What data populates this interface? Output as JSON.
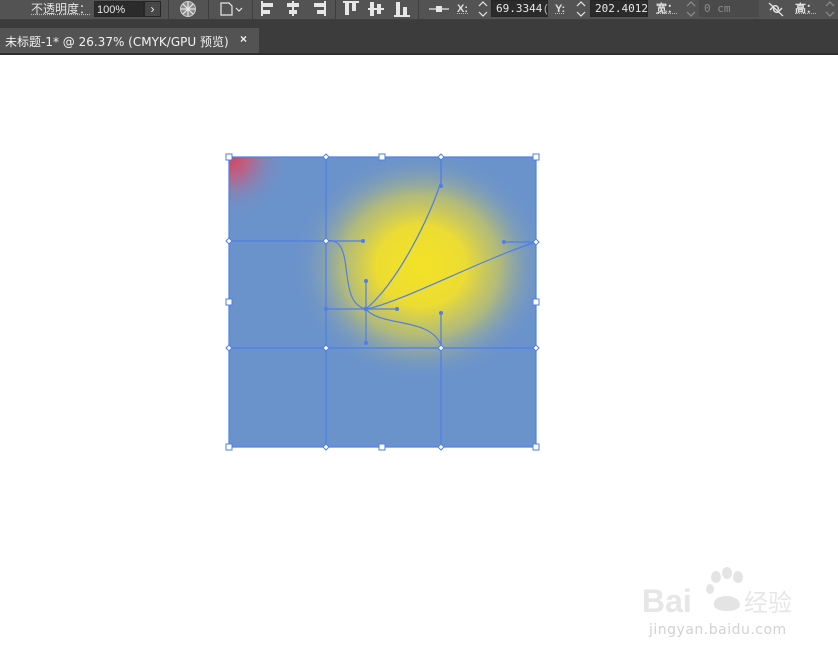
{
  "control_bar": {
    "opacity_label": "不透明度：",
    "opacity_value": "100%",
    "opacity_dropdown_glyph": "›",
    "recolor_icon": "recolor-artwork-icon",
    "shape_menu_icon": "document-shape-dropdown-icon",
    "align_icons": [
      "align-left-icon",
      "align-horizontal-center-icon",
      "align-right-icon",
      "align-top-icon",
      "align-vertical-center-icon",
      "align-bottom-icon"
    ],
    "reference_point_icon": "reference-point-icon",
    "x_label": "X:",
    "x_value": "69.3344",
    "x_trailing": "(",
    "y_label": "Y:",
    "y_value": "202.4012",
    "width_label": "宽：",
    "width_value": "0 cm",
    "link_icon": "constrain-proportions-link-icon",
    "height_label": "高："
  },
  "tab_bar": {
    "tab_title": "未标题-1* @ 26.37% (CMYK/GPU 预览)",
    "close_glyph": "×"
  },
  "artwork": {
    "type": "gradient-mesh",
    "base_color": "#6b93cb",
    "highlight_color": "#f3e226",
    "corner_color": "#d3435f",
    "selection_color": "#4f7ee8"
  },
  "watermark": {
    "logo_text": "Bai du 经验",
    "url": "jingyan.baidu.com"
  }
}
